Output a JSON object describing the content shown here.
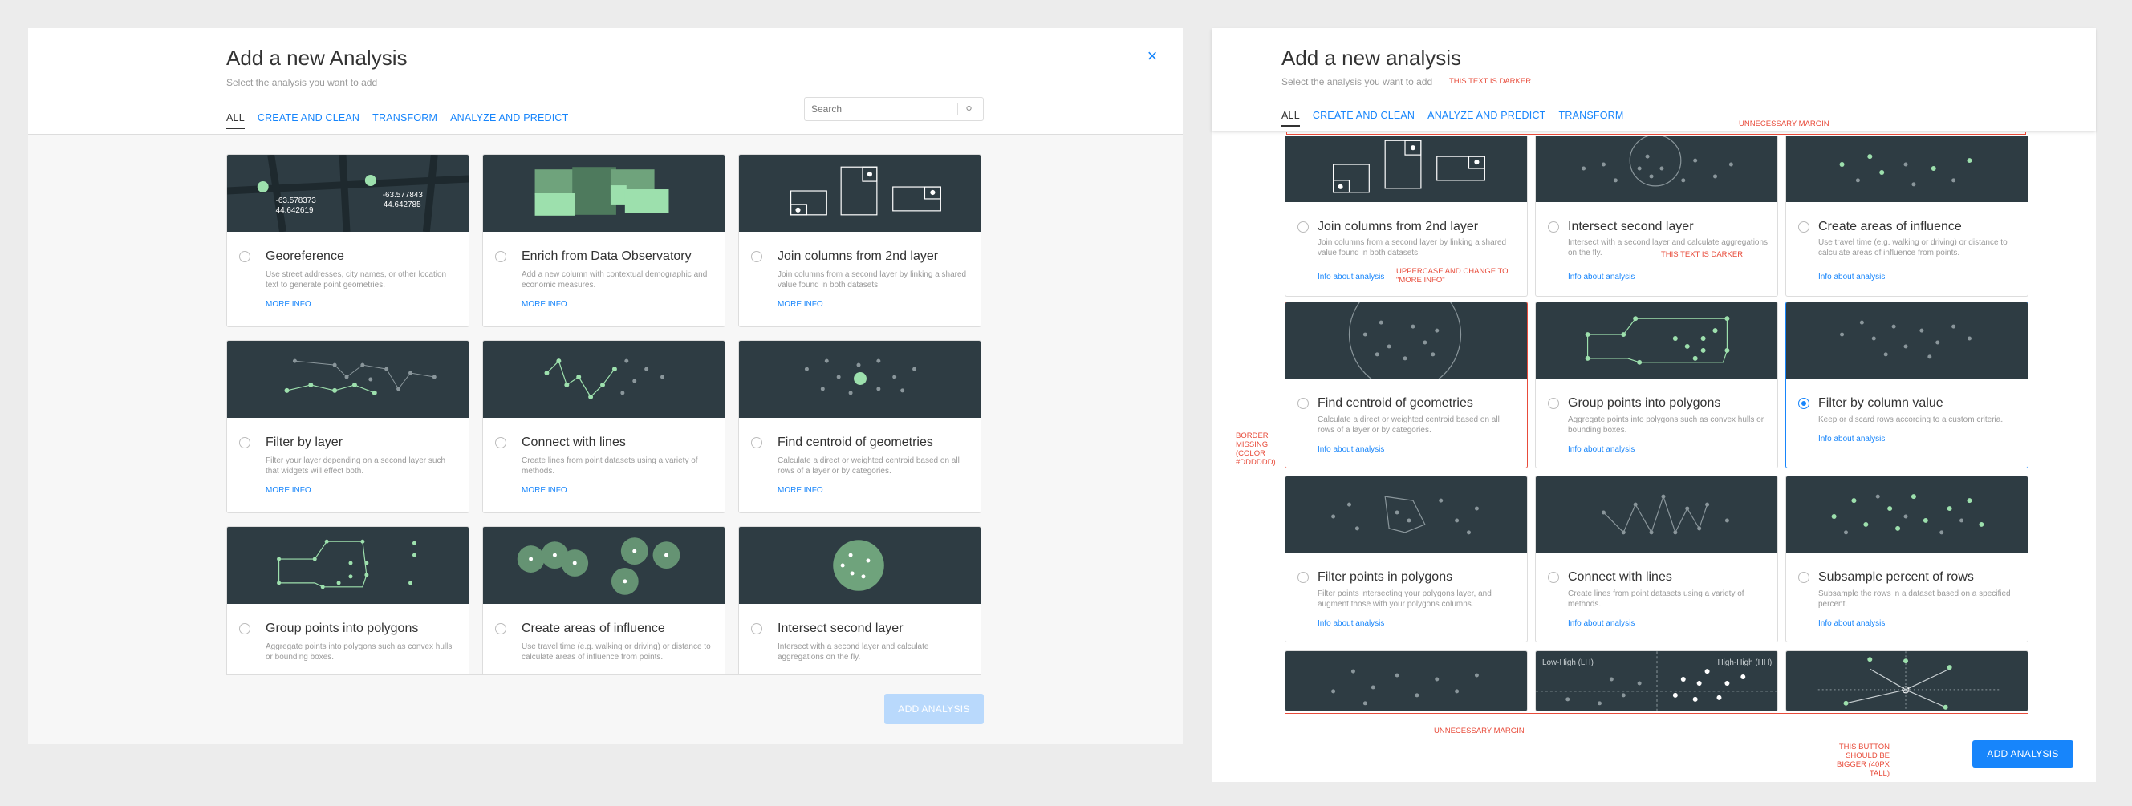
{
  "left": {
    "title": "Add a new Analysis",
    "subtitle": "Select the analysis you want to add",
    "tabs": [
      "ALL",
      "CREATE AND CLEAN",
      "TRANSFORM",
      "ANALYZE AND PREDICT"
    ],
    "search_placeholder": "Search",
    "cards": [
      {
        "title": "Georeference",
        "desc": "Use street addresses, city names, or other location text to generate point geometries.",
        "link": "MORE INFO",
        "coord1": "-63.578373",
        "coord2": "44.642619",
        "coord3": "-63.577843",
        "coord4": "44.642785"
      },
      {
        "title": "Enrich from Data Observatory",
        "desc": "Add a new column with contextual demographic and economic measures.",
        "link": "MORE INFO"
      },
      {
        "title": "Join columns from 2nd layer",
        "desc": "Join columns from a second layer by linking a shared value found in both datasets.",
        "link": "MORE INFO"
      },
      {
        "title": "Filter by layer",
        "desc": "Filter your layer depending on a second layer such that widgets will effect both.",
        "link": "MORE INFO"
      },
      {
        "title": "Connect with lines",
        "desc": "Create lines from point datasets using a variety of methods.",
        "link": "MORE INFO"
      },
      {
        "title": "Find centroid of geometries",
        "desc": "Calculate a direct or weighted centroid based on all rows of a layer or by categories.",
        "link": "MORE INFO"
      },
      {
        "title": "Group points into polygons",
        "desc": "Aggregate points into polygons such as convex hulls or bounding boxes.",
        "link": ""
      },
      {
        "title": "Create areas of influence",
        "desc": "Use travel time (e.g. walking or driving) or distance to calculate areas of influence from points.",
        "link": ""
      },
      {
        "title": "Intersect second layer",
        "desc": "Intersect with a second layer and calculate aggregations on the fly.",
        "link": ""
      }
    ],
    "button": "ADD ANALYSIS"
  },
  "right": {
    "title": "Add a new analysis",
    "subtitle": "Select the analysis you want to add",
    "tabs": [
      "ALL",
      "CREATE AND CLEAN",
      "ANALYZE AND PREDICT",
      "TRANSFORM"
    ],
    "cards": [
      {
        "title": "Join columns from 2nd layer",
        "desc": "Join columns from a second layer by linking a shared value found in both datasets.",
        "link": "Info about analysis"
      },
      {
        "title": "Intersect second layer",
        "desc": "Intersect with a second layer and calculate aggregations on the fly.",
        "link": "Info about analysis"
      },
      {
        "title": "Create areas of influence",
        "desc": "Use travel time (e.g. walking or driving) or distance to calculate areas of influence from points.",
        "link": "Info about analysis"
      },
      {
        "title": "Find centroid of geometries",
        "desc": "Calculate a direct or weighted centroid based on all rows of a layer or by categories.",
        "link": "Info about analysis"
      },
      {
        "title": "Group points into polygons",
        "desc": "Aggregate points into polygons such as convex hulls or bounding boxes.",
        "link": "Info about analysis"
      },
      {
        "title": "Filter by column value",
        "desc": "Keep or discard rows according to a custom criteria.",
        "link": "Info about analysis"
      },
      {
        "title": "Filter points in polygons",
        "desc": "Filter points intersecting your polygons layer, and augment those with your polygons columns.",
        "link": "Info about analysis"
      },
      {
        "title": "Connect with lines",
        "desc": "Create lines from point datasets using a variety of methods.",
        "link": "Info about analysis"
      },
      {
        "title": "Subsample percent of rows",
        "desc": "Subsample the rows in a dataset based on a specified percent.",
        "link": "Info about analysis"
      }
    ],
    "quad_labels": {
      "lh": "Low-High (LH)",
      "hh": "High-High (HH)"
    },
    "button": "ADD ANALYSIS",
    "annotations": {
      "darker1": "THIS TEXT IS DARKER",
      "darker2": "THIS TEXT IS DARKER",
      "margin_top": "UNNECESSARY MARGIN",
      "margin_bottom": "UNNECESSARY MARGIN",
      "uppercase": "UPPERCASE AND CHANGE TO \"MORE INFO\"",
      "border": "BORDER MISSING (color #DDDDDD)",
      "button": "THIS BUTTON SHOULD BE BIGGER (40PX TALL)"
    }
  },
  "colors": {
    "accent": "#1785fb",
    "card_art": "#2e3c43",
    "green": "#9de0ad",
    "annotation": "#e84b3a"
  }
}
